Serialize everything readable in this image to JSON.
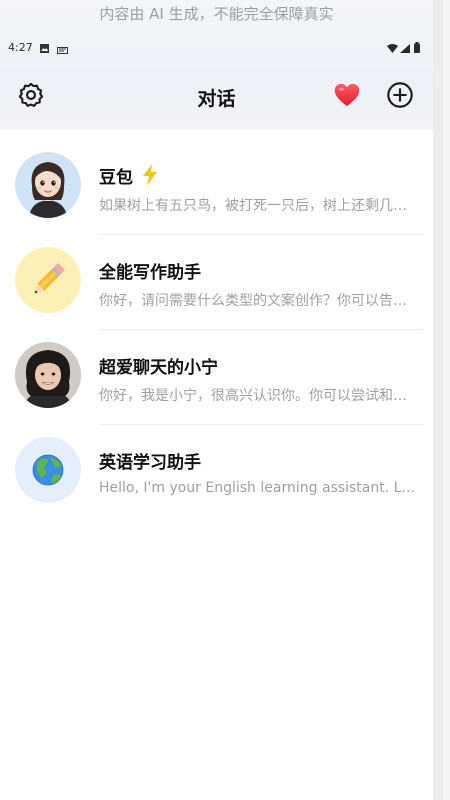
{
  "notice": "内容由 AI 生成，不能完全保障真实",
  "status_bar": {
    "time": "4:27"
  },
  "header": {
    "title": "对话"
  },
  "conversations": [
    {
      "name": "豆包",
      "preview": "如果树上有五只鸟，被打死一只后，树上还剩几只鸟？",
      "avatar_icon": "girl-avatar-icon",
      "badge_icon": "lightning-icon"
    },
    {
      "name": "全能写作助手",
      "preview": "你好，请问需要什么类型的文案创作？你可以告诉我",
      "avatar_icon": "pencil-icon"
    },
    {
      "name": "超爱聊天的小宁",
      "preview": "你好，我是小宁，很高兴认识你。你可以尝试和我聊天",
      "avatar_icon": "woman-photo-avatar"
    },
    {
      "name": "英语学习助手",
      "preview": "Hello, I'm your English learning assistant. Let's start",
      "avatar_icon": "globe-icon"
    }
  ],
  "colors": {
    "accent_heart": "#ee2b3a",
    "bolt": "#f5c518",
    "pencil_bg": "#fdf0b7",
    "globe_bg": "#e4eefc",
    "avatar1_bg": "#cfe4f6"
  }
}
